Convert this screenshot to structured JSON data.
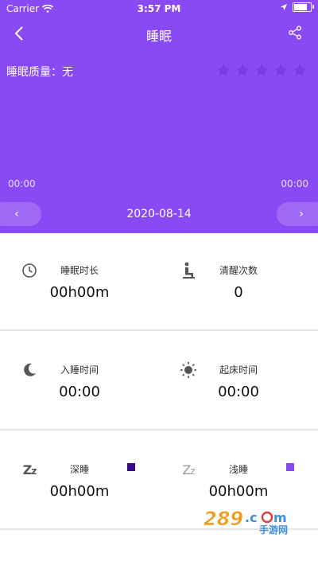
{
  "status_bar": {
    "carrier": "Carrier",
    "time": "3:57 PM"
  },
  "nav": {
    "title": "睡眠"
  },
  "quality": {
    "label": "睡眠质量：无",
    "rating": 0,
    "max_rating": 5
  },
  "timeline": {
    "start": "00:00",
    "end": "00:00"
  },
  "date_bar": {
    "date": "2020-08-14",
    "prev": "‹",
    "next": "›"
  },
  "stats": {
    "duration": {
      "label": "睡眠时长",
      "value": "00h00m"
    },
    "awake_count": {
      "label": "清醒次数",
      "value": "0"
    },
    "sleep_time": {
      "label": "入睡时间",
      "value": "00:00"
    },
    "wake_time": {
      "label": "起床时间",
      "value": "00:00"
    },
    "deep_sleep": {
      "label": "深睡",
      "value": "00h00m",
      "color": "#3a0a8a"
    },
    "light_sleep": {
      "label": "浅睡",
      "value": "00h00m",
      "color": "#8a4af3"
    }
  },
  "colors": {
    "header": "#8a4af3",
    "divider": "#e4e4e4"
  },
  "watermark": {
    "text": "289.com 手游网"
  }
}
